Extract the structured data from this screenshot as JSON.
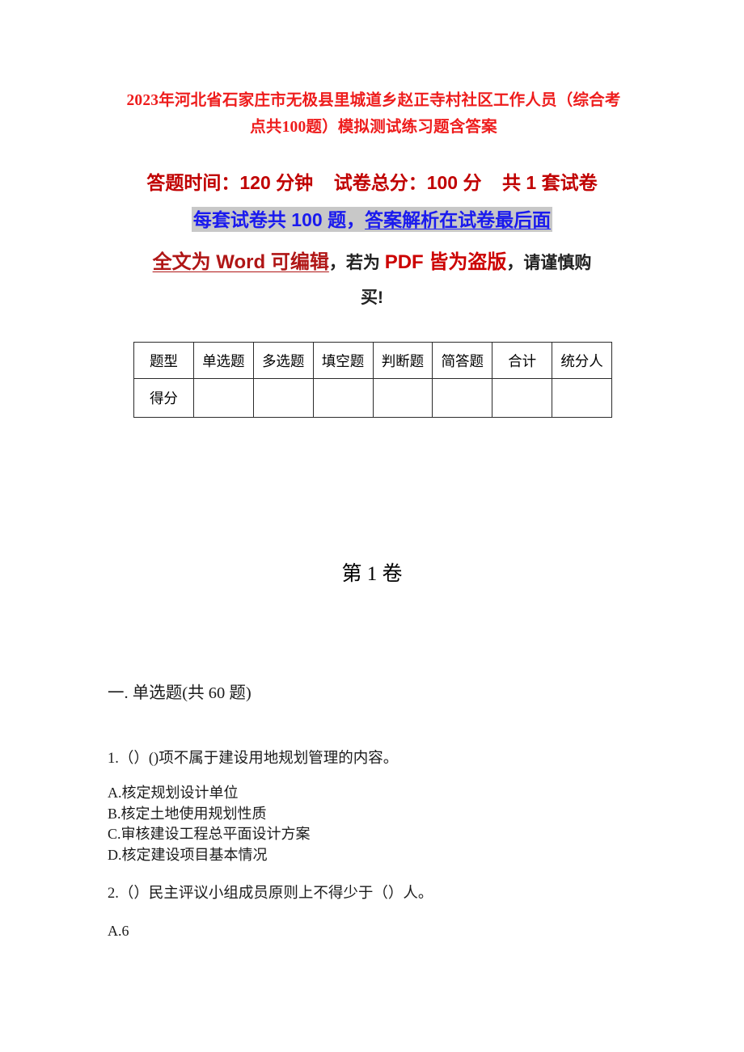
{
  "document": {
    "title": "2023年河北省石家庄市无极县里城道乡赵正寺村社区工作人员（综合考点共100题）模拟测试练习题含答案",
    "colors": {
      "title_red": "#ee1c1c",
      "banner_red": "#c00000",
      "highlight_blue": "#1a1aee",
      "highlight_bg": "#c8c8c8",
      "warning_red": "#cc0000",
      "body_text": "#1b1b1b"
    }
  },
  "banner": {
    "line1": "答题时间：120 分钟    试卷总分：100 分    共 1 套试卷",
    "line2_plain": "每套试卷共 100 题，",
    "line2_underlined": "答案解析在试卷最后面",
    "line3_part1": "全文为 Word 可编辑",
    "line3_part2": "，若为 ",
    "line3_part3": "PDF 皆为盗版",
    "line3_part4": "，请谨慎购",
    "line4": "买!"
  },
  "score_table": {
    "headers": [
      "题型",
      "单选题",
      "多选题",
      "填空题",
      "判断题",
      "简答题",
      "合计",
      "统分人"
    ],
    "rows": [
      {
        "label": "得分",
        "cells": [
          "",
          "",
          "",
          "",
          "",
          "",
          ""
        ]
      }
    ]
  },
  "volume": {
    "heading": "第 1 卷"
  },
  "section": {
    "heading": "一. 单选题(共 60 题)"
  },
  "questions": [
    {
      "number": "1.",
      "stem": "1.（）()项不属于建设用地规划管理的内容。",
      "options": [
        "A.核定规划设计单位",
        "B.核定土地使用规划性质",
        "C.审核建设工程总平面设计方案",
        "D.核定建设项目基本情况"
      ]
    },
    {
      "number": "2.",
      "stem": "2.（）民主评议小组成员原则上不得少于（）人。",
      "options": [
        "A.6"
      ]
    }
  ]
}
